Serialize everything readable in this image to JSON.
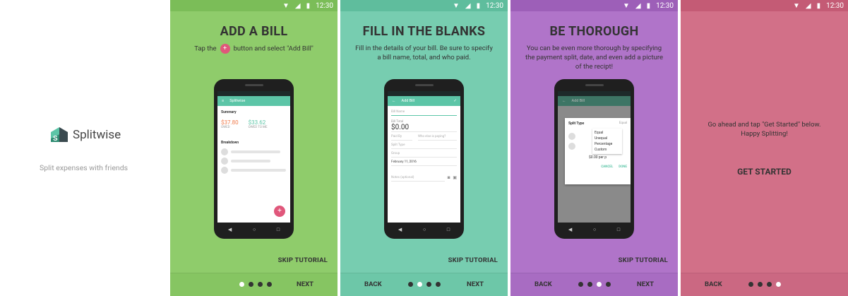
{
  "status": {
    "time": "12:30"
  },
  "splash": {
    "logo_text": "Splitwise",
    "tagline": "Split expenses with friends"
  },
  "slide1": {
    "title": "ADD A BILL",
    "desc_before": "Tap the",
    "desc_after": "button and select \"Add Bill\"",
    "plus": "+",
    "phone": {
      "appbar": "Splitwise",
      "summary": "Summary",
      "owed_amount": "$37.80",
      "owed_label": "OWED",
      "owed_to_me_amount": "$33.62",
      "owed_to_me_label": "OWED TO ME",
      "breakdown": "Breakdown"
    },
    "skip": "SKIP TUTORIAL",
    "next": "NEXT"
  },
  "slide2": {
    "title": "FILL IN THE BLANKS",
    "desc": "Fill in the details of your bill. Be sure to specify a bill name, total, and who paid.",
    "phone": {
      "appbar": "Add Bill",
      "bill_name": "Bill Name",
      "bill_total_label": "Bill Total",
      "bill_total": "$0.00",
      "paid_by": "Paid By",
      "who_paying": "Who else is paying?",
      "split_type": "Split Type",
      "group": "Group",
      "date": "February 11, 2016",
      "notes": "Notes (optional)"
    },
    "skip": "SKIP TUTORIAL",
    "back": "BACK",
    "next": "NEXT"
  },
  "slide3": {
    "title": "BE THOROUGH",
    "desc": "You can be even more thorough by specifying the payment split, date, and even add a picture of the recipt!",
    "phone": {
      "appbar": "Add Bill",
      "dialog_title": "Split Type",
      "dialog_select": "Equal",
      "options": [
        "Equal",
        "Unequal",
        "Percentage",
        "Custom"
      ],
      "per_person": "$0.00 per p",
      "cancel": "CANCEL",
      "done": "DONE"
    },
    "skip": "SKIP TUTORIAL",
    "back": "BACK",
    "next": "NEXT"
  },
  "slide4": {
    "text_line1": "Go ahead and tap \"Get Started\" below.",
    "text_line2": "Happy Splitting!",
    "get_started": "GET STARTED",
    "back": "BACK"
  },
  "colors": {
    "green": "#8fcc6b",
    "teal": "#77cdb0",
    "purple": "#b074c9",
    "pink": "#d27088",
    "accent_pink": "#e0577b",
    "owed_orange": "#f07a4a",
    "owed_green": "#5cc5a7"
  }
}
